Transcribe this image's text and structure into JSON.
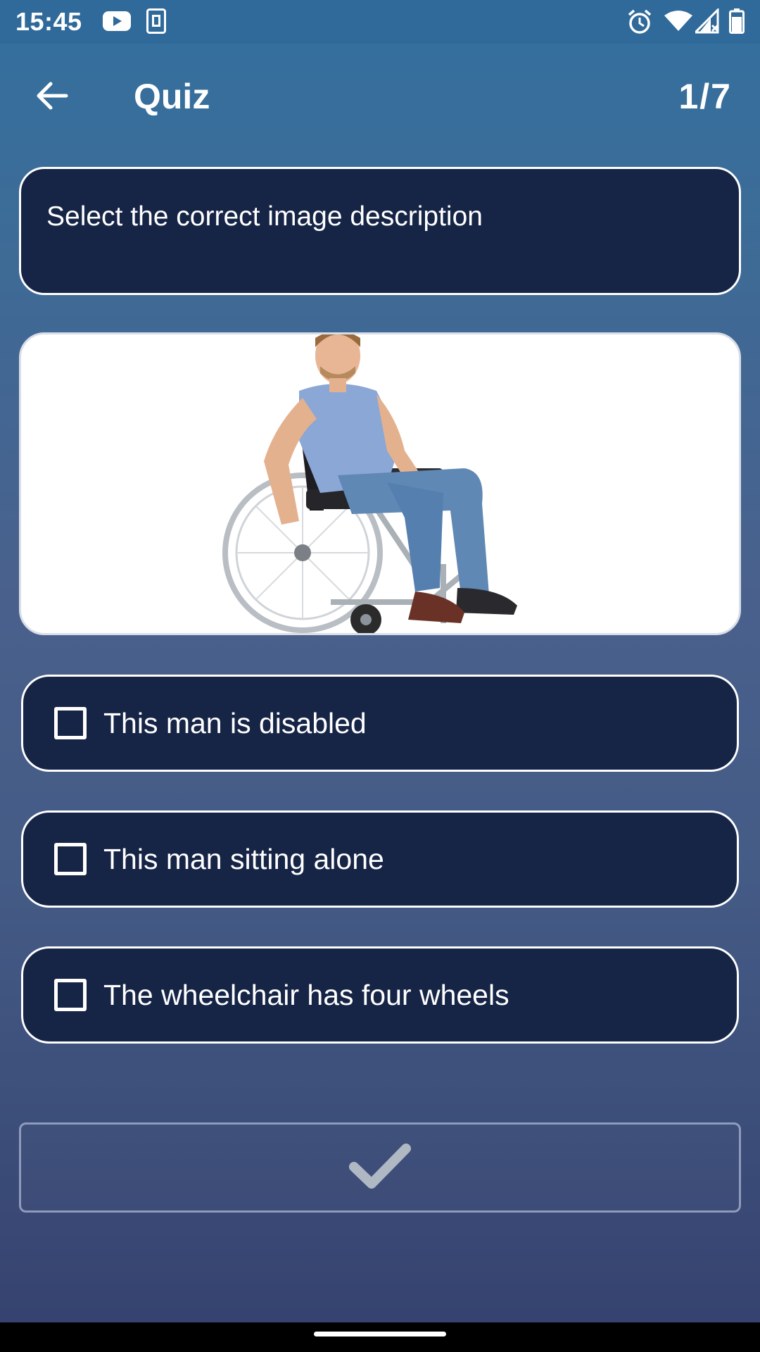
{
  "status_bar": {
    "time": "15:45",
    "left_icons": [
      "youtube-icon",
      "sim-card-icon"
    ],
    "right_icons": [
      "alarm-icon",
      "wifi-icon",
      "signal-icon",
      "battery-icon"
    ]
  },
  "app_bar": {
    "title": "Quiz",
    "progress": "1/7",
    "back_icon": "arrow-left-icon"
  },
  "question": {
    "text": "Select the correct image description"
  },
  "image": {
    "subject": "man-in-wheelchair"
  },
  "options": [
    {
      "label": "This man is disabled",
      "checked": false
    },
    {
      "label": "This man sitting alone",
      "checked": false
    },
    {
      "label": "The wheelchair has four wheels",
      "checked": false
    }
  ],
  "submit": {
    "icon": "checkmark-icon",
    "icon_color": "#b0b8c4"
  },
  "colors": {
    "card_bg": "#162446",
    "accent_border": "#ffffff",
    "gradient_top": "#33709f",
    "gradient_bottom": "#35416e"
  }
}
